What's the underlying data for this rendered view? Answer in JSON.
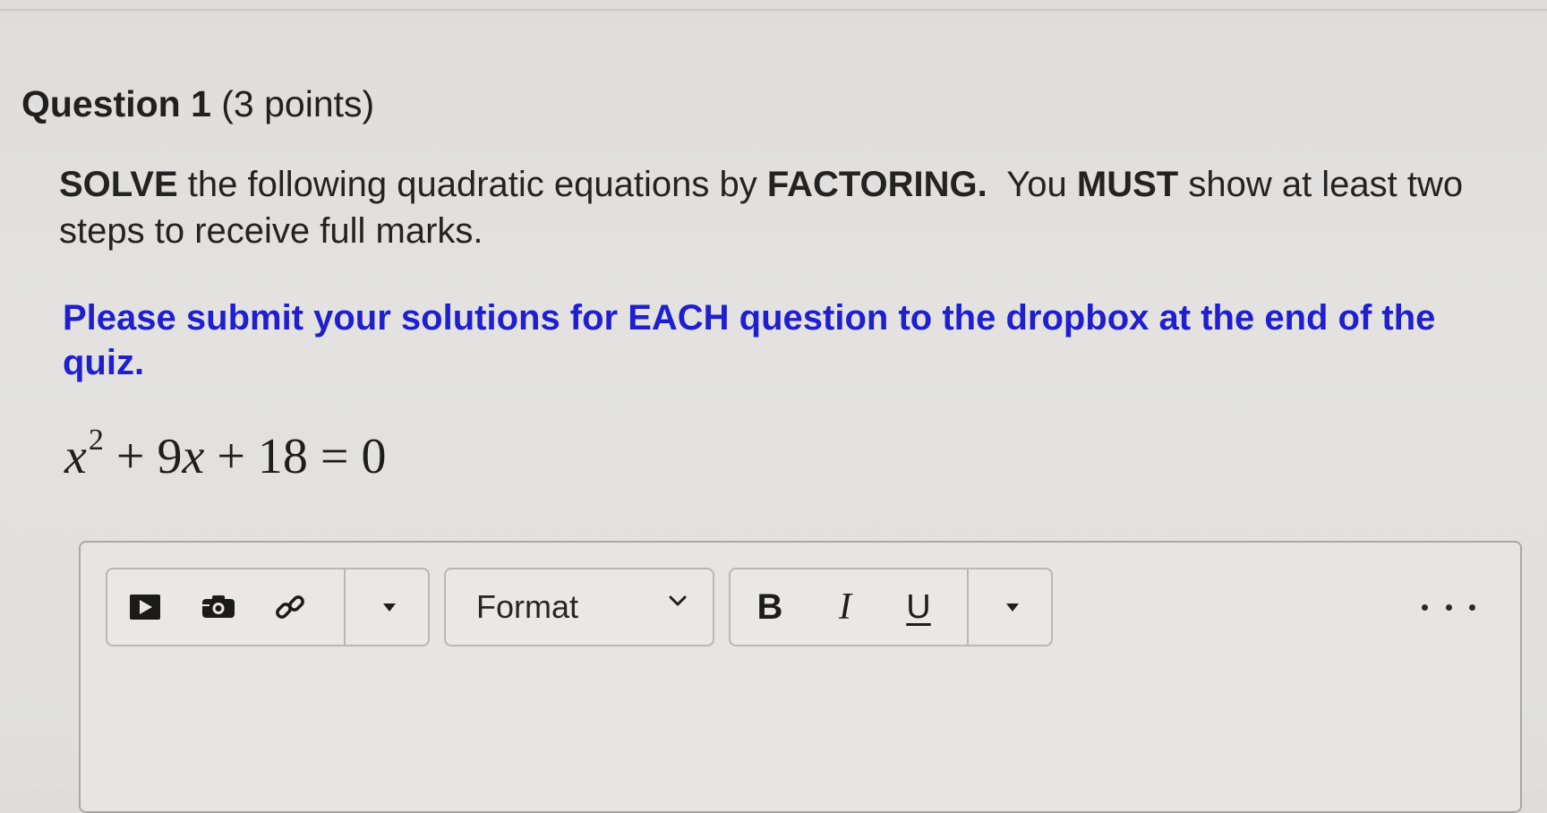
{
  "question": {
    "title": "Question 1",
    "points": "(3 points)"
  },
  "instructions": {
    "part1": "SOLVE",
    "part2": " the following quadratic equations by ",
    "part3": "FACTORING.",
    "part4": "  You ",
    "part5": "MUST",
    "part6": " show at least two steps to receive full marks."
  },
  "notice": "Please submit your solutions for EACH question to the dropbox at the end of the quiz.",
  "equation": {
    "var1": "x",
    "exp": "2",
    "op1": " + 9",
    "var2": "x",
    "rest": " + 18 = 0"
  },
  "editor": {
    "toolbar": {
      "insert_media_icon": "play-box-icon",
      "insert_image_icon": "camera-icon",
      "insert_link_icon": "link-icon",
      "format_select_value": "Format",
      "bold_label": "B",
      "italic_label": "I",
      "underline_label": "U"
    }
  },
  "colors": {
    "notice_blue": "#1f1fd0",
    "background": "#e0dfdd"
  }
}
